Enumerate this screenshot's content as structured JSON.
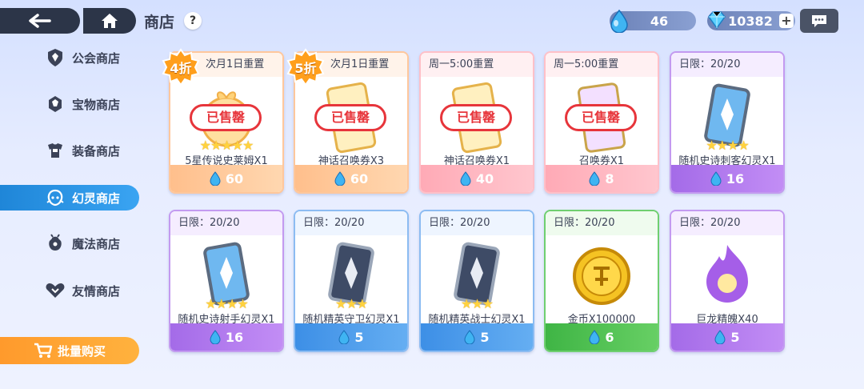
{
  "header": {
    "title": "商店",
    "help": "?",
    "gem_count": "46",
    "diamond_count": "10382",
    "plus": "+"
  },
  "sidebar": {
    "items": [
      {
        "label": "公会商店",
        "icon": "guild-shield-icon"
      },
      {
        "label": "宝物商店",
        "icon": "treasure-icon"
      },
      {
        "label": "装备商店",
        "icon": "armor-icon"
      },
      {
        "label": "幻灵商店",
        "icon": "spirit-icon",
        "active": true
      },
      {
        "label": "魔法商店",
        "icon": "magic-bag-icon"
      },
      {
        "label": "友情商店",
        "icon": "friendship-icon"
      }
    ],
    "bulk_label": "批量购买"
  },
  "cards": [
    {
      "header": "次月1日重置",
      "name": "5星传说史莱姆X1",
      "price": "60",
      "theme": "orange",
      "sold_out": true,
      "discount": "4折",
      "sold_label": "已售罄"
    },
    {
      "header": "次月1日重置",
      "name": "神话召唤券X3",
      "price": "60",
      "theme": "orange",
      "sold_out": true,
      "discount": "5折",
      "sold_label": "已售罄"
    },
    {
      "header": "周一5:00重置",
      "name": "神话召唤券X1",
      "price": "40",
      "theme": "red",
      "sold_out": true,
      "sold_label": "已售罄"
    },
    {
      "header": "周一5:00重置",
      "name": "召唤券X1",
      "price": "8",
      "theme": "red",
      "sold_out": true,
      "sold_label": "已售罄"
    },
    {
      "header": "日限：20/20",
      "name": "随机史诗刺客幻灵X1",
      "price": "16",
      "theme": "purple",
      "sold_out": false
    },
    {
      "header": "日限：20/20",
      "name": "随机史诗射手幻灵X1",
      "price": "16",
      "theme": "purple",
      "sold_out": false
    },
    {
      "header": "日限：20/20",
      "name": "随机精英守卫幻灵X1",
      "price": "5",
      "theme": "blue",
      "sold_out": false
    },
    {
      "header": "日限：20/20",
      "name": "随机精英战士幻灵X1",
      "price": "5",
      "theme": "blue",
      "sold_out": false
    },
    {
      "header": "日限：20/20",
      "name": "金币X100000",
      "price": "6",
      "theme": "green",
      "sold_out": false
    },
    {
      "header": "日限：20/20",
      "name": "巨龙精魄X40",
      "price": "5",
      "theme": "purple",
      "sold_out": false
    }
  ],
  "colors": {
    "active_tab": "#2a95e6",
    "bulk_button": "#ffa534",
    "sold_stamp": "#e7353b"
  }
}
